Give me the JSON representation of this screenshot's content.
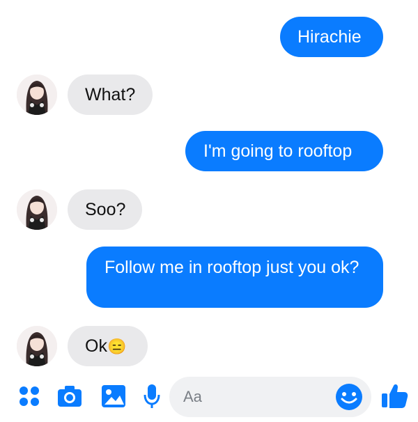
{
  "conversation": {
    "messages": [
      {
        "sender": "me",
        "text": "Hirachie"
      },
      {
        "sender": "them",
        "text": "What?"
      },
      {
        "sender": "me",
        "text": "I'm going to rooftop"
      },
      {
        "sender": "them",
        "text": "Soo?"
      },
      {
        "sender": "me",
        "text": "Follow me in rooftop just you ok?"
      },
      {
        "sender": "them",
        "text": "Ok",
        "emoji": "😑"
      }
    ]
  },
  "composer": {
    "placeholder": "Aa",
    "icons": [
      "apps-dots-icon",
      "camera-icon",
      "gallery-image-icon",
      "microphone-icon",
      "emoji-icon",
      "thumbs-up-icon"
    ]
  },
  "colors": {
    "outgoing": "#0a7cff",
    "incoming": "#e9e9eb",
    "accent": "#0a7cff"
  }
}
